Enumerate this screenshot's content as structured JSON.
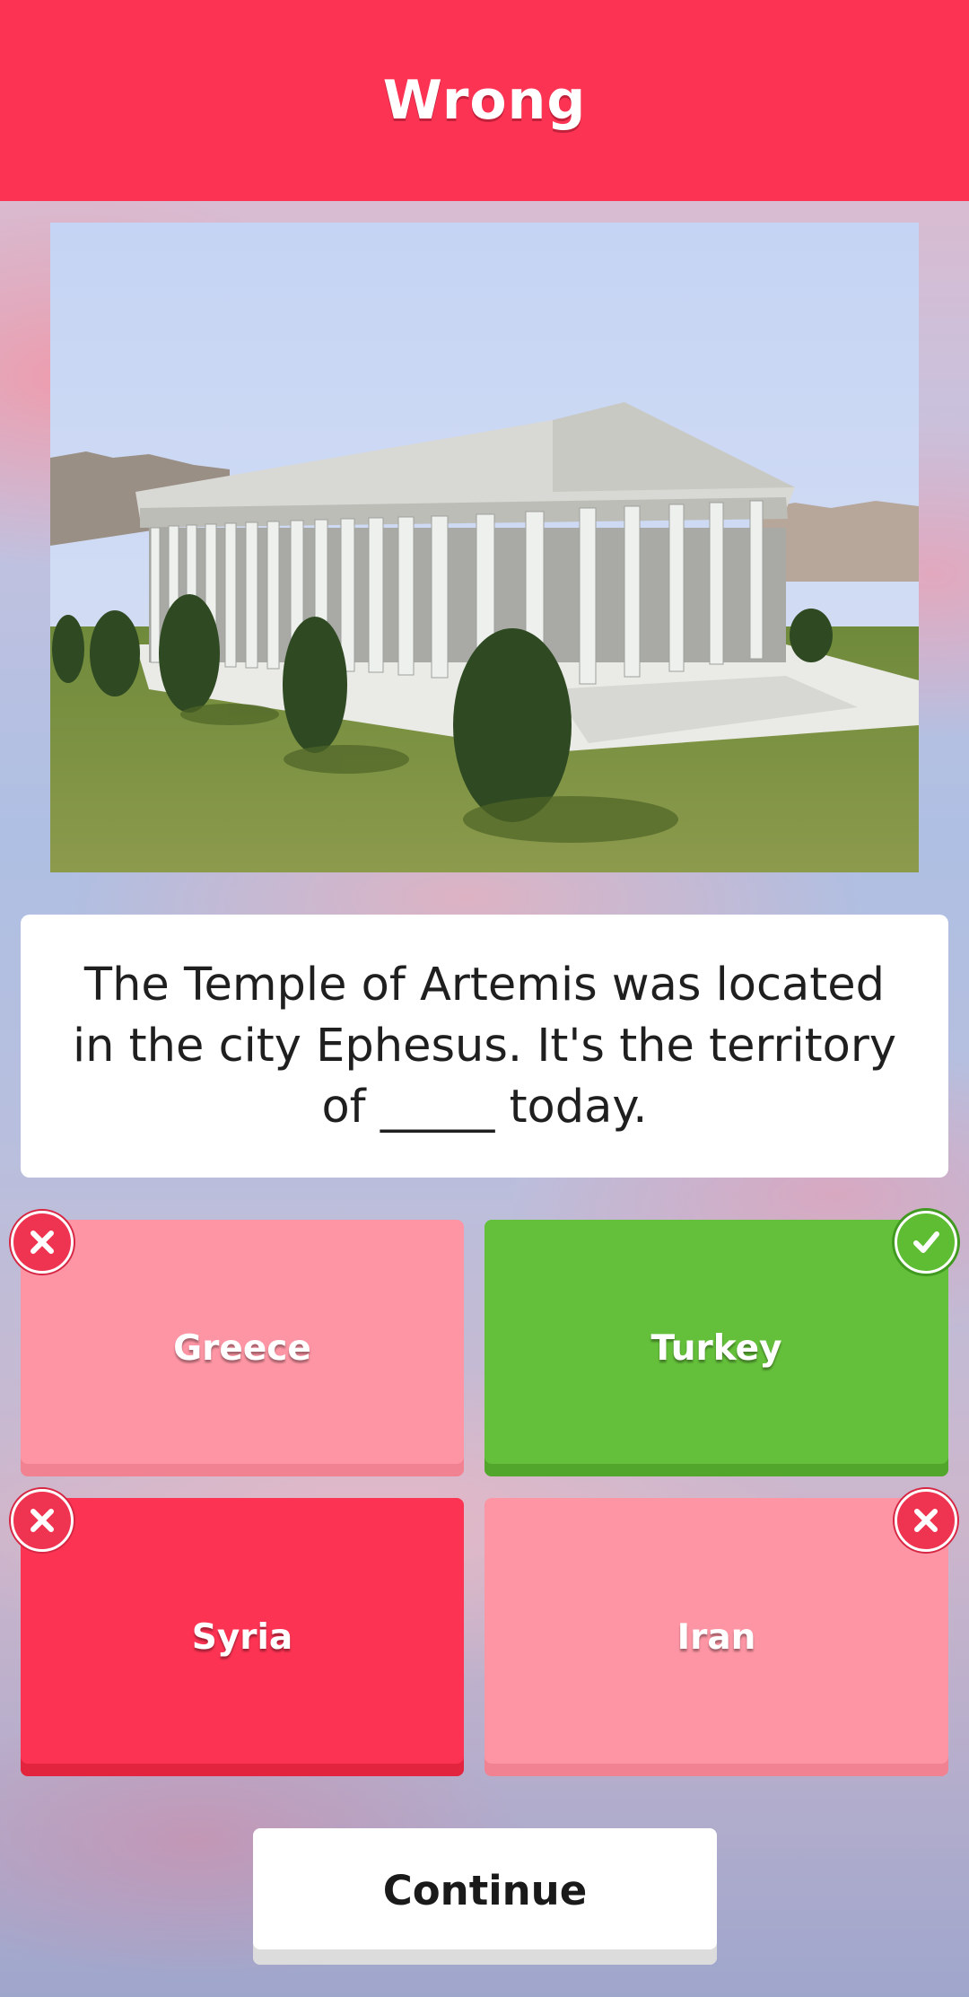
{
  "header": {
    "title": "Wrong",
    "color": "#fd3353"
  },
  "photo": {
    "subject": "temple-of-artemis-model"
  },
  "question": {
    "text": "The Temple of Artemis was located in the city Ephesus. It's the territory of _____ today."
  },
  "answers": [
    {
      "label": "Greece",
      "state": "faded",
      "mark": "wrong"
    },
    {
      "label": "Turkey",
      "state": "correct",
      "mark": "right"
    },
    {
      "label": "Syria",
      "state": "picked",
      "mark": "wrong"
    },
    {
      "label": "Iran",
      "state": "faded",
      "mark": "wrong"
    }
  ],
  "colors": {
    "wrong": "#fd3353",
    "faded": "#fd95a4",
    "correct": "#64c03a"
  },
  "continue_button": {
    "label": "Continue"
  }
}
